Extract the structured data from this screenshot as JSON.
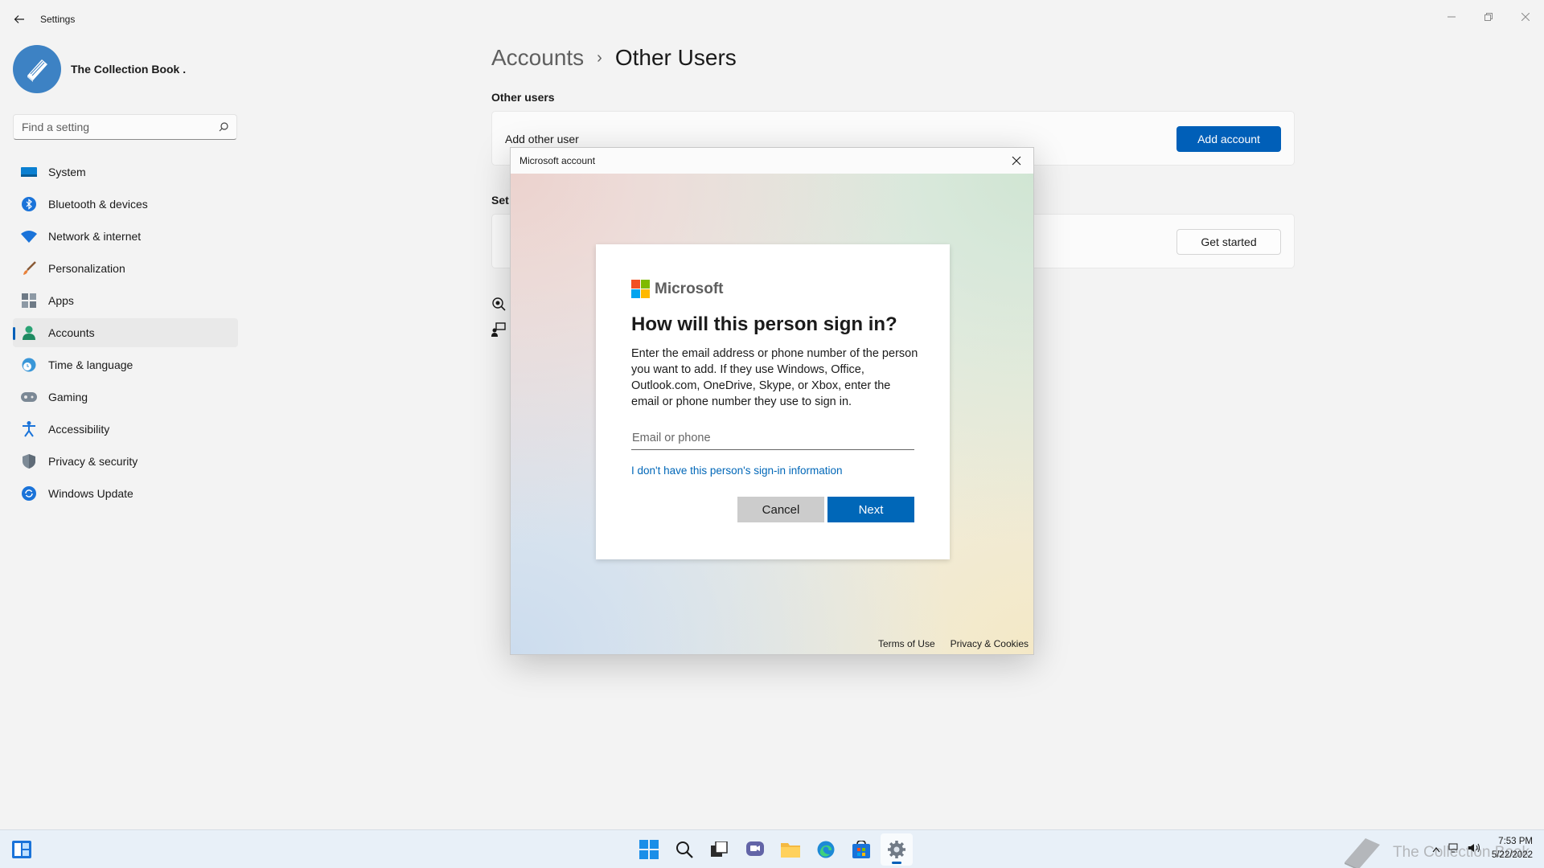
{
  "window": {
    "title": "Settings"
  },
  "profile": {
    "name": "The Collection Book ."
  },
  "search": {
    "placeholder": "Find a setting"
  },
  "sidebar": {
    "items": [
      {
        "label": "System",
        "icon": "monitor-icon"
      },
      {
        "label": "Bluetooth & devices",
        "icon": "bluetooth-icon"
      },
      {
        "label": "Network & internet",
        "icon": "wifi-icon"
      },
      {
        "label": "Personalization",
        "icon": "brush-icon"
      },
      {
        "label": "Apps",
        "icon": "apps-icon"
      },
      {
        "label": "Accounts",
        "icon": "person-icon",
        "active": true
      },
      {
        "label": "Time & language",
        "icon": "globe-clock-icon"
      },
      {
        "label": "Gaming",
        "icon": "gamepad-icon"
      },
      {
        "label": "Accessibility",
        "icon": "accessibility-icon"
      },
      {
        "label": "Privacy & security",
        "icon": "shield-icon"
      },
      {
        "label": "Windows Update",
        "icon": "update-icon"
      }
    ]
  },
  "main": {
    "breadcrumb_parent": "Accounts",
    "breadcrumb_separator": "›",
    "breadcrumb_current": "Other Users",
    "section_other_users": "Other users",
    "add_other_user_label": "Add other user",
    "add_account_button": "Add account",
    "section2_partial": "Set",
    "get_started_button": "Get started"
  },
  "dialog": {
    "title": "Microsoft account",
    "brand": "Microsoft",
    "heading": "How will this person sign in?",
    "description": "Enter the email address or phone number of the person you want to add. If they use Windows, Office, Outlook.com, OneDrive, Skype, or Xbox, enter the email or phone number they use to sign in.",
    "input_placeholder": "Email or phone",
    "input_value": "",
    "no_info_link": "I don't have this person's sign-in information",
    "cancel_button": "Cancel",
    "next_button": "Next",
    "footer_terms": "Terms of Use",
    "footer_privacy": "Privacy & Cookies"
  },
  "taskbar": {
    "apps": [
      "start-icon",
      "search-icon",
      "task-view-icon",
      "chat-icon",
      "file-explorer-icon",
      "edge-icon",
      "store-icon",
      "settings-icon"
    ],
    "clock_time": "7:53 PM",
    "clock_date": "5/22/2022",
    "watermark": "The Collection Book"
  },
  "colors": {
    "accent": "#005fb8",
    "ms_red": "#f25022",
    "ms_green": "#7fba00",
    "ms_blue": "#00a4ef",
    "ms_yellow": "#ffb900",
    "link": "#0067b8"
  }
}
